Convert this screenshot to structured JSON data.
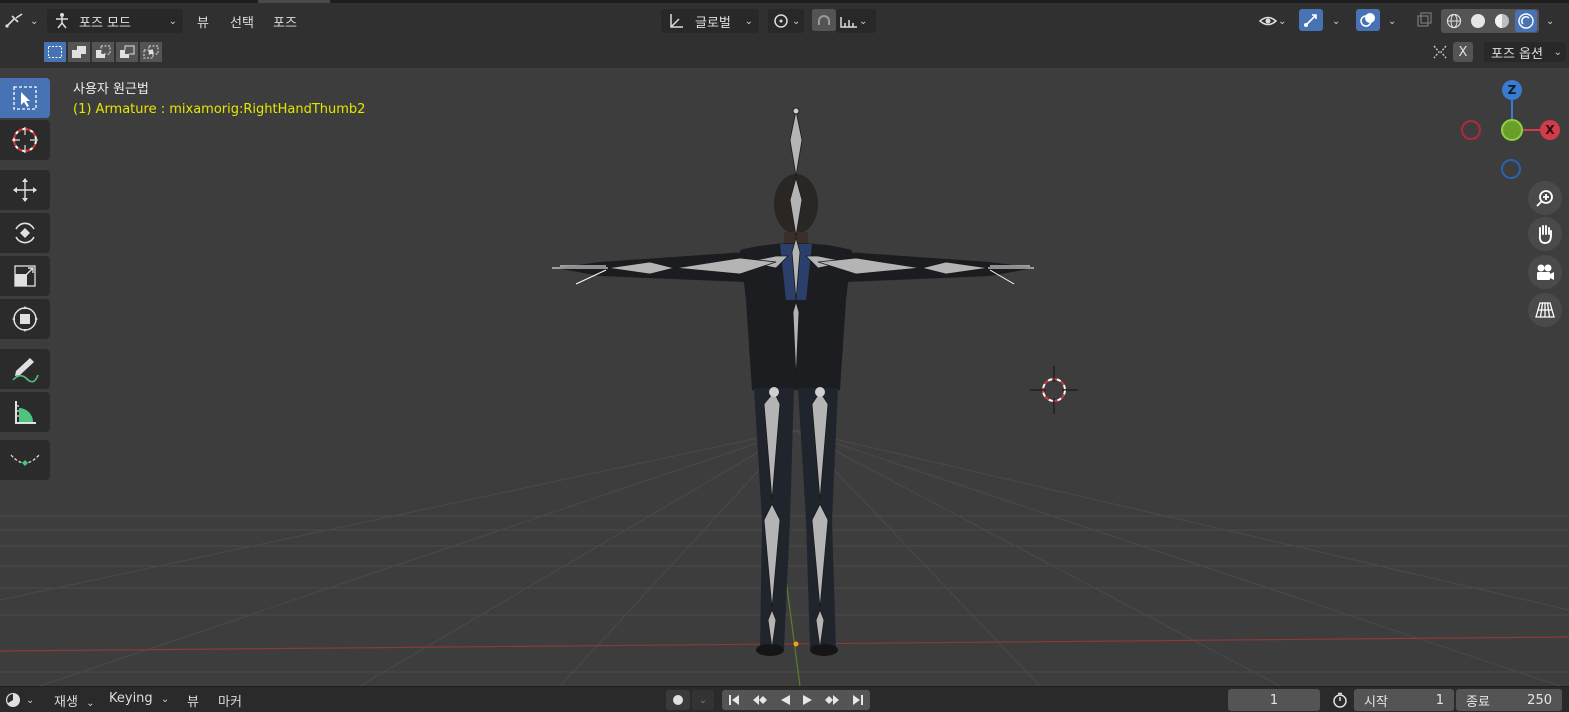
{
  "header": {
    "editor_type_icon": "armature-editor-icon",
    "mode": {
      "label": "포즈 모드",
      "icon": "pose-mode-icon"
    },
    "menus": [
      "뷰",
      "선택",
      "포즈"
    ],
    "transform_orientation": {
      "label": "글로벌",
      "icon": "orientation-axes-icon"
    },
    "overlay_buttons": [
      "pivot-icon",
      "snap-magnet-icon",
      "snap-increment-icon"
    ],
    "view_buttons": [
      "visibility-eye-icon",
      "gizmo-icon",
      "overlay-icon",
      "xray-icon"
    ],
    "shading_modes": [
      "wireframe",
      "solid",
      "material-preview",
      "rendered"
    ],
    "active_shading": "rendered",
    "accent_color": "#4772b3"
  },
  "toolbar2": {
    "select_modes": [
      "set",
      "extend",
      "subtract",
      "invert",
      "intersect"
    ],
    "active_select_mode": "set",
    "mirror_x_label": "X",
    "pose_options_label": "포즈 옵션"
  },
  "viewport": {
    "view_name": "사용자 원근법",
    "object_info": "(1) Armature : mixamorig:RightHandThumb2",
    "object_info_color": "#e6e600",
    "tools": [
      "select-box-icon",
      "cursor-icon",
      "move-icon",
      "rotate-icon",
      "scale-icon",
      "transform-icon",
      "annotate-icon",
      "measure-icon",
      "relax-pose-icon"
    ],
    "active_tool": "select-box-icon",
    "gizmo": {
      "z": "Z",
      "x": "X"
    },
    "nav_buttons": [
      "zoom-icon",
      "pan-hand-icon",
      "camera-icon",
      "perspective-grid-icon"
    ]
  },
  "timeline": {
    "editor_icon": "timeline-clock-icon",
    "playback_label": "재생",
    "keying_label": "Keying",
    "view_label": "뷰",
    "marker_label": "마커",
    "current_frame": "1",
    "start_label": "시작",
    "start_value": "1",
    "end_label": "종료",
    "end_value": "250"
  }
}
